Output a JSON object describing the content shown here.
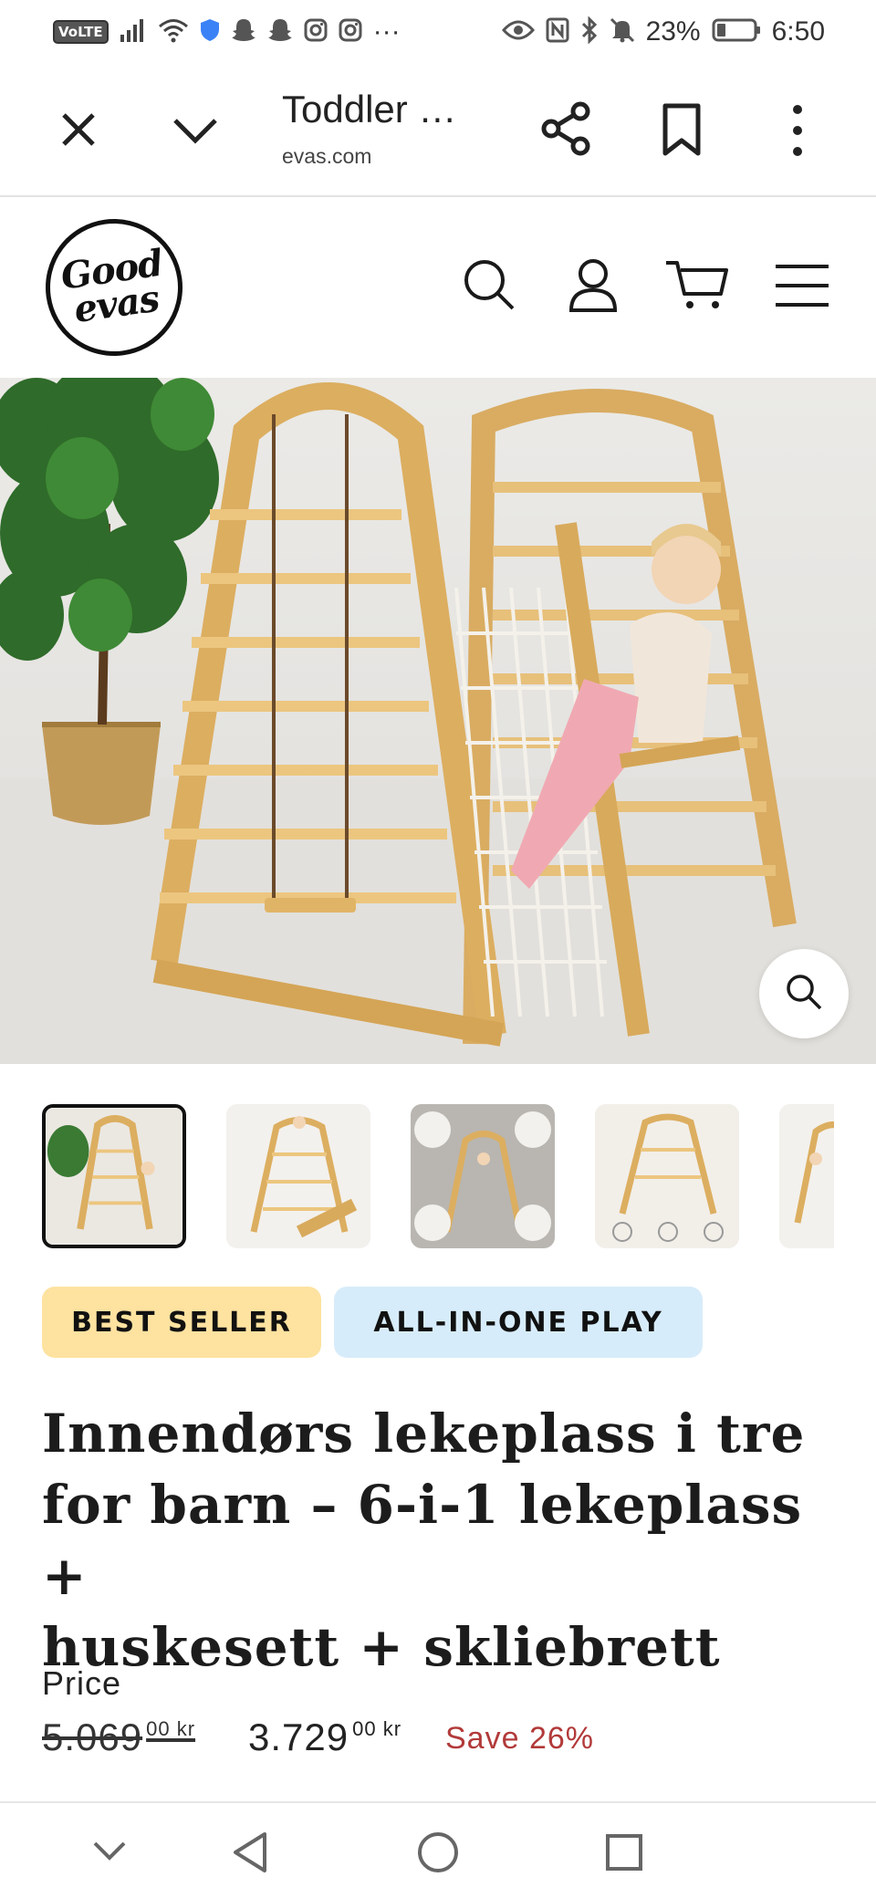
{
  "status_bar": {
    "volte": "VoLTE",
    "left_more": "···",
    "battery": "23%",
    "time": "6:50",
    "icons": [
      "signal-icon",
      "wifi-icon",
      "shield-icon",
      "snapchat-icon",
      "snapchat-icon",
      "instagram-icon",
      "instagram-icon",
      "eye-icon",
      "nfc-icon",
      "bluetooth-icon",
      "mute-icon",
      "battery-icon"
    ]
  },
  "browser": {
    "tab_title": "Toddler …",
    "url": "evas.com",
    "icons": [
      "close-icon",
      "chevron-down-icon",
      "share-icon",
      "bookmark-icon",
      "more-vertical-icon"
    ]
  },
  "site_header": {
    "logo_line1": "Good",
    "logo_line2": "evas",
    "icons": [
      "search-icon",
      "account-icon",
      "cart-icon",
      "hamburger-menu-icon"
    ]
  },
  "gallery": {
    "main_image": "wooden-indoor-playground-with-child",
    "zoom_icon": "zoom-search-icon",
    "thumbnails": [
      "thumb-1",
      "thumb-2",
      "thumb-3",
      "thumb-4",
      "thumb-5"
    ],
    "active_thumbnail": 0
  },
  "badges": {
    "best_seller": "BEST SELLER",
    "all_in_one": "ALL-IN-ONE PLAY",
    "best_seller_color": "#fde2a0",
    "all_in_one_color": "#d7ecfa"
  },
  "product": {
    "title_line1": "Innendørs lekeplass i tre",
    "title_line2": "for barn – 6-i-1 lekeplass +",
    "title_line3": "huskesett + skliebrett",
    "price_label": "Price",
    "old_price_main": "5.069",
    "old_price_sup": "00 kr",
    "new_price_main": "3.729",
    "new_price_sup": "00 kr",
    "save_text": "Save 26%",
    "save_color": "#b23a3a"
  },
  "nav_bar": {
    "icons": [
      "nav-down-icon",
      "back-icon",
      "home-icon",
      "recents-icon"
    ]
  }
}
